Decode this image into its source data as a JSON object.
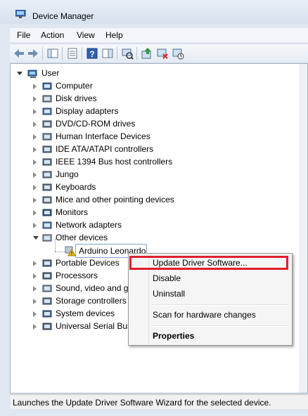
{
  "window": {
    "title": "Device Manager"
  },
  "menu": [
    "File",
    "Action",
    "View",
    "Help"
  ],
  "toolbar": {
    "buttons": [
      "back-icon",
      "forward-icon",
      "console-tree-icon",
      "properties-icon",
      "help-icon",
      "action-pane-icon",
      "scan-hardware-icon",
      "update-driver-icon",
      "uninstall-icon",
      "disable-icon"
    ]
  },
  "tree": {
    "root": "User",
    "items": [
      {
        "label": "Computer",
        "icon": "computer-icon"
      },
      {
        "label": "Disk drives",
        "icon": "disk-drive-icon"
      },
      {
        "label": "Display adapters",
        "icon": "display-adapter-icon"
      },
      {
        "label": "DVD/CD-ROM drives",
        "icon": "dvd-drive-icon"
      },
      {
        "label": "Human Interface Devices",
        "icon": "hid-icon"
      },
      {
        "label": "IDE ATA/ATAPI controllers",
        "icon": "ide-controller-icon"
      },
      {
        "label": "IEEE 1394 Bus host controllers",
        "icon": "ieee1394-icon"
      },
      {
        "label": "Jungo",
        "icon": "jungo-icon"
      },
      {
        "label": "Keyboards",
        "icon": "keyboard-icon"
      },
      {
        "label": "Mice and other pointing devices",
        "icon": "mouse-icon"
      },
      {
        "label": "Monitors",
        "icon": "monitor-icon"
      },
      {
        "label": "Network adapters",
        "icon": "network-adapter-icon"
      },
      {
        "label": "Other devices",
        "icon": "other-devices-icon"
      },
      {
        "label": "Portable Devices",
        "icon": "portable-device-icon"
      },
      {
        "label": "Processors",
        "icon": "processor-icon"
      },
      {
        "label": "Sound, video and ga",
        "icon": "sound-icon"
      },
      {
        "label": "Storage controllers",
        "icon": "storage-controller-icon"
      },
      {
        "label": "System devices",
        "icon": "system-devices-icon"
      },
      {
        "label": "Universal Serial Bus",
        "icon": "usb-icon"
      }
    ],
    "child": {
      "label": "Arduino Leonardo",
      "icon": "warning-device-icon"
    }
  },
  "context_menu": {
    "items": [
      "Update Driver Software...",
      "Disable",
      "Uninstall",
      "Scan for hardware changes",
      "Properties"
    ]
  },
  "status": "Launches the Update Driver Software Wizard for the selected device.",
  "colors": {
    "highlight": "#e01e2d",
    "selection": "#7da2ce"
  }
}
